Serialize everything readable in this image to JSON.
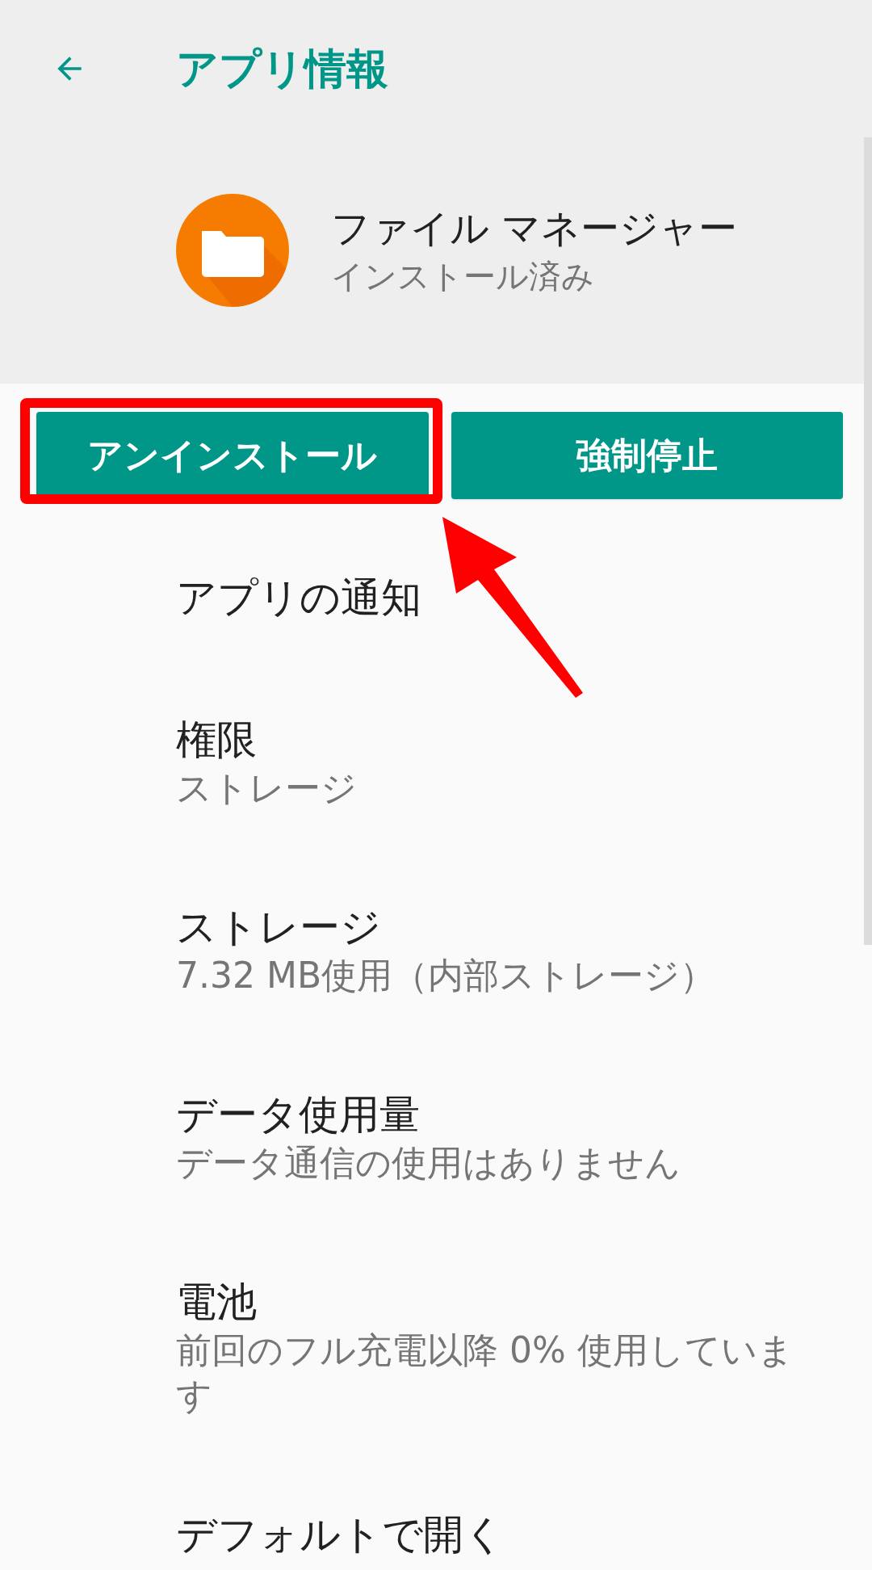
{
  "toolbar": {
    "title": "アプリ情報"
  },
  "app": {
    "name": "ファイル マネージャー",
    "status": "インストール済み"
  },
  "buttons": [
    {
      "label": "アンインストール"
    },
    {
      "label": "強制停止"
    }
  ],
  "items": [
    {
      "title": "アプリの通知"
    },
    {
      "title": "権限",
      "subtitle": "ストレージ"
    },
    {
      "title": "ストレージ",
      "subtitle": "7.32 MB使用（内部ストレージ）"
    },
    {
      "title": "データ使用量",
      "subtitle": "データ通信の使用はありません"
    },
    {
      "title": "電池",
      "subtitle": "前回のフル充電以降 0% 使用しています"
    },
    {
      "title": "デフォルトで開く"
    }
  ]
}
